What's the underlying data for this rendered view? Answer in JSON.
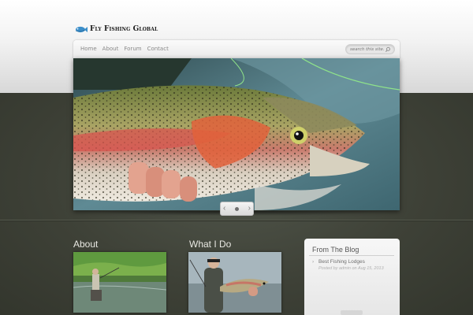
{
  "site": {
    "logo_text": "Fly Fishing Global",
    "logo_icon": "fish-icon"
  },
  "nav": {
    "items": [
      "Home",
      "About",
      "Forum",
      "Contact"
    ]
  },
  "search": {
    "placeholder": "search this site...",
    "icon": "search-icon"
  },
  "slider": {
    "prev_icon": "chevron-left-icon",
    "next_icon": "chevron-right-icon",
    "prev_label": "‹",
    "next_label": "›"
  },
  "widgets": {
    "about_title": "About",
    "whatido_title": "What I Do",
    "blog_title": "From The Blog",
    "blog_posts": [
      {
        "title": "Best Fishing Lodges",
        "meta": "Posted by admin on Aug 15, 2013"
      }
    ]
  },
  "colors": {
    "background_dark": "#3e4137",
    "header_light": "#f2f2f2",
    "fish_red_stripe": "#d8564f"
  }
}
